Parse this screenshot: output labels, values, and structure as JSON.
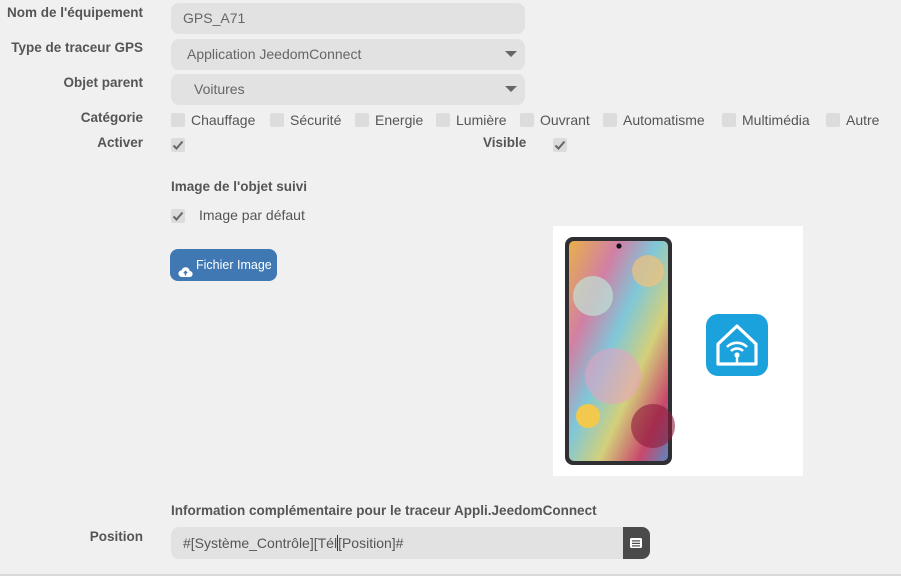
{
  "form": {
    "name_label": "Nom de l'équipement",
    "name_value": "GPS_A71",
    "tracker_label": "Type de traceur GPS",
    "tracker_value": "Application JeedomConnect",
    "parent_label": "Objet parent",
    "parent_value": "Voitures",
    "category_label": "Catégorie",
    "categories": [
      "Chauffage",
      "Sécurité",
      "Energie",
      "Lumière",
      "Ouvrant",
      "Automatisme",
      "Multimédia",
      "Autre"
    ],
    "activate_label": "Activer",
    "activate_checked": true,
    "visible_label": "Visible",
    "visible_checked": true
  },
  "image_section": {
    "title": "Image de l'objet suivi",
    "default_label": "Image par défaut",
    "default_checked": true,
    "file_button": "Fichier Image",
    "preview_icons": [
      "smartphone-image",
      "jeedom-connect-app-icon"
    ]
  },
  "extra": {
    "title": "Information complémentaire pour le traceur Appli.JeedomConnect",
    "position_label": "Position",
    "position_value_before_cursor": "#[Système_Contrôle][Tél",
    "position_value_after_cursor": "[Position]#",
    "position_button_icon": "list-icon"
  },
  "colors": {
    "primary_button": "#3f78b2",
    "app_icon": "#1ba1dc",
    "background": "#f0f0f0",
    "field_bg": "#e2e2e2"
  }
}
